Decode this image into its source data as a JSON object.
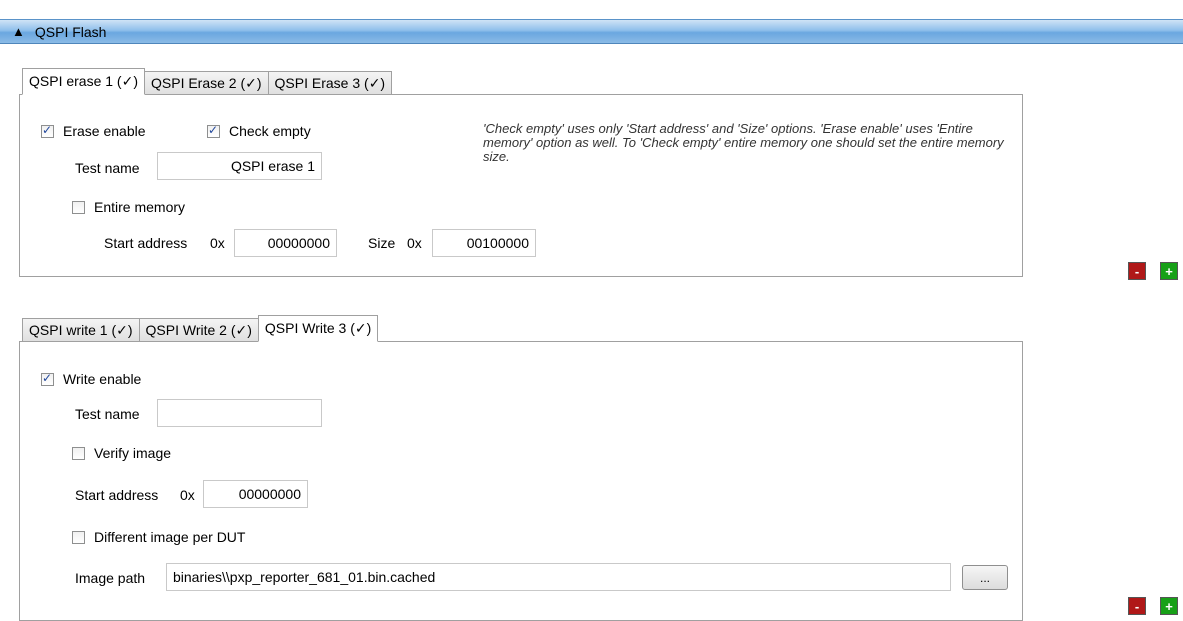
{
  "header": {
    "arrow": "▲",
    "title": "QSPI Flash"
  },
  "erase": {
    "tabs": [
      "QSPI erase 1 (✓)",
      "QSPI Erase 2 (✓)",
      "QSPI Erase 3 (✓)"
    ],
    "active_tab": 0,
    "erase_enable_label": "Erase enable",
    "check_empty_label": "Check empty",
    "test_name_label": "Test name",
    "test_name_value": "QSPI erase 1",
    "entire_memory_label": "Entire memory",
    "start_address_label": "Start address",
    "hex_prefix": "0x",
    "start_address_value": "00000000",
    "size_label": "Size",
    "size_value": "00100000",
    "note": "'Check empty' uses only 'Start address' and 'Size' options. 'Erase enable' uses 'Entire memory' option as well. To 'Check empty' entire memory one should set the entire memory size."
  },
  "write": {
    "tabs": [
      "QSPI write 1 (✓)",
      "QSPI Write 2 (✓)",
      "QSPI Write 3 (✓)"
    ],
    "active_tab": 2,
    "write_enable_label": "Write enable",
    "test_name_label": "Test name",
    "test_name_value": "",
    "verify_image_label": "Verify image",
    "start_address_label": "Start address",
    "hex_prefix": "0x",
    "start_address_value": "00000000",
    "different_image_label": "Different image per DUT",
    "image_path_label": "Image path",
    "image_path_value": "binaries\\\\pxp_reporter_681_01.bin.cached",
    "browse_label": "..."
  },
  "controls": {
    "remove_label": "-",
    "add_label": "+"
  }
}
